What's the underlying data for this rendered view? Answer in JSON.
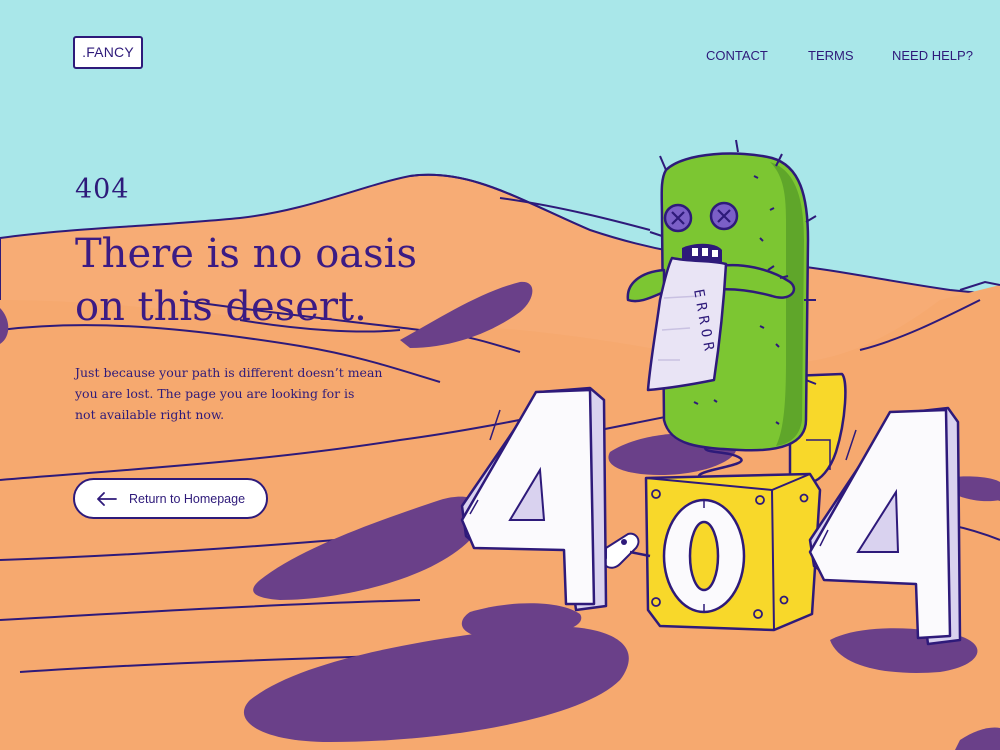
{
  "header": {
    "logo": ".FANCY",
    "nav": [
      {
        "label": "CONTACT"
      },
      {
        "label": "TERMS"
      },
      {
        "label": "NEED HELP?"
      }
    ]
  },
  "main": {
    "code": "404",
    "headline_line1": "There is no oasis",
    "headline_line2": "on this desert.",
    "description_line1": "Just because your path is different doesn’t mean",
    "description_line2": "you are lost. The page you are looking for is",
    "description_line3": "not available right now.",
    "button_label": "Return to Homepage"
  },
  "illustration": {
    "note_letters": [
      "E",
      "R",
      "R",
      "O",
      "R"
    ],
    "big_digits": [
      "4",
      "0",
      "4"
    ],
    "icons": [
      "cactus-character",
      "error-note",
      "jack-in-the-box",
      "wind-up-key",
      "arrow-left-icon"
    ]
  },
  "colors": {
    "sky": "#a9e7e9",
    "sand": "#f7ac75",
    "shadow": "#6a4089",
    "ink": "#2e1a7a",
    "cactus": "#7cc632",
    "box": "#f8d82a"
  }
}
